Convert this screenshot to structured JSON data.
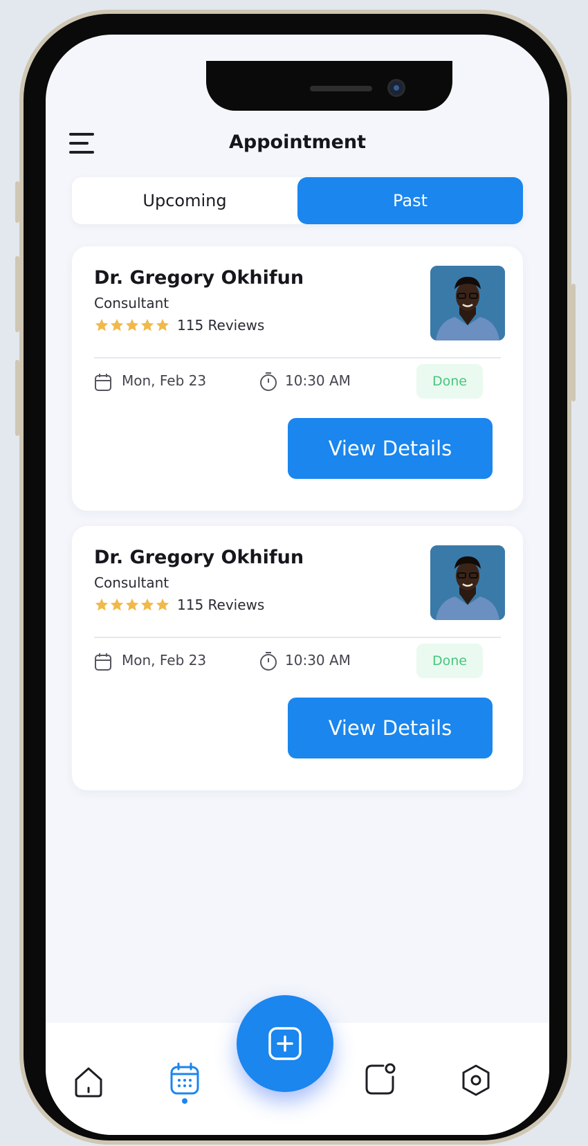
{
  "header": {
    "title": "Appointment"
  },
  "tabs": [
    {
      "label": "Upcoming",
      "active": false
    },
    {
      "label": "Past",
      "active": true
    }
  ],
  "appointments": [
    {
      "doctor": "Dr. Gregory Okhifun",
      "role": "Consultant",
      "rating": 5,
      "reviews": "115 Reviews",
      "date": "Mon, Feb 23",
      "time": "10:30 AM",
      "status": "Done",
      "button": "View Details"
    },
    {
      "doctor": "Dr. Gregory Okhifun",
      "role": "Consultant",
      "rating": 5,
      "reviews": "115 Reviews",
      "date": "Mon, Feb 23",
      "time": "10:30 AM",
      "status": "Done",
      "button": "View Details"
    }
  ],
  "bottom_nav": {
    "items": [
      {
        "icon": "home-icon",
        "active": false
      },
      {
        "icon": "calendar-icon",
        "active": true
      },
      {
        "icon": "add-icon",
        "active": false
      },
      {
        "icon": "notification-icon",
        "active": false
      },
      {
        "icon": "settings-icon",
        "active": false
      }
    ]
  },
  "colors": {
    "accent": "#1a86ee",
    "star": "#f0b94a",
    "done_text": "#47c67d",
    "done_bg": "#eafaf0",
    "background": "#f4f6fb"
  }
}
